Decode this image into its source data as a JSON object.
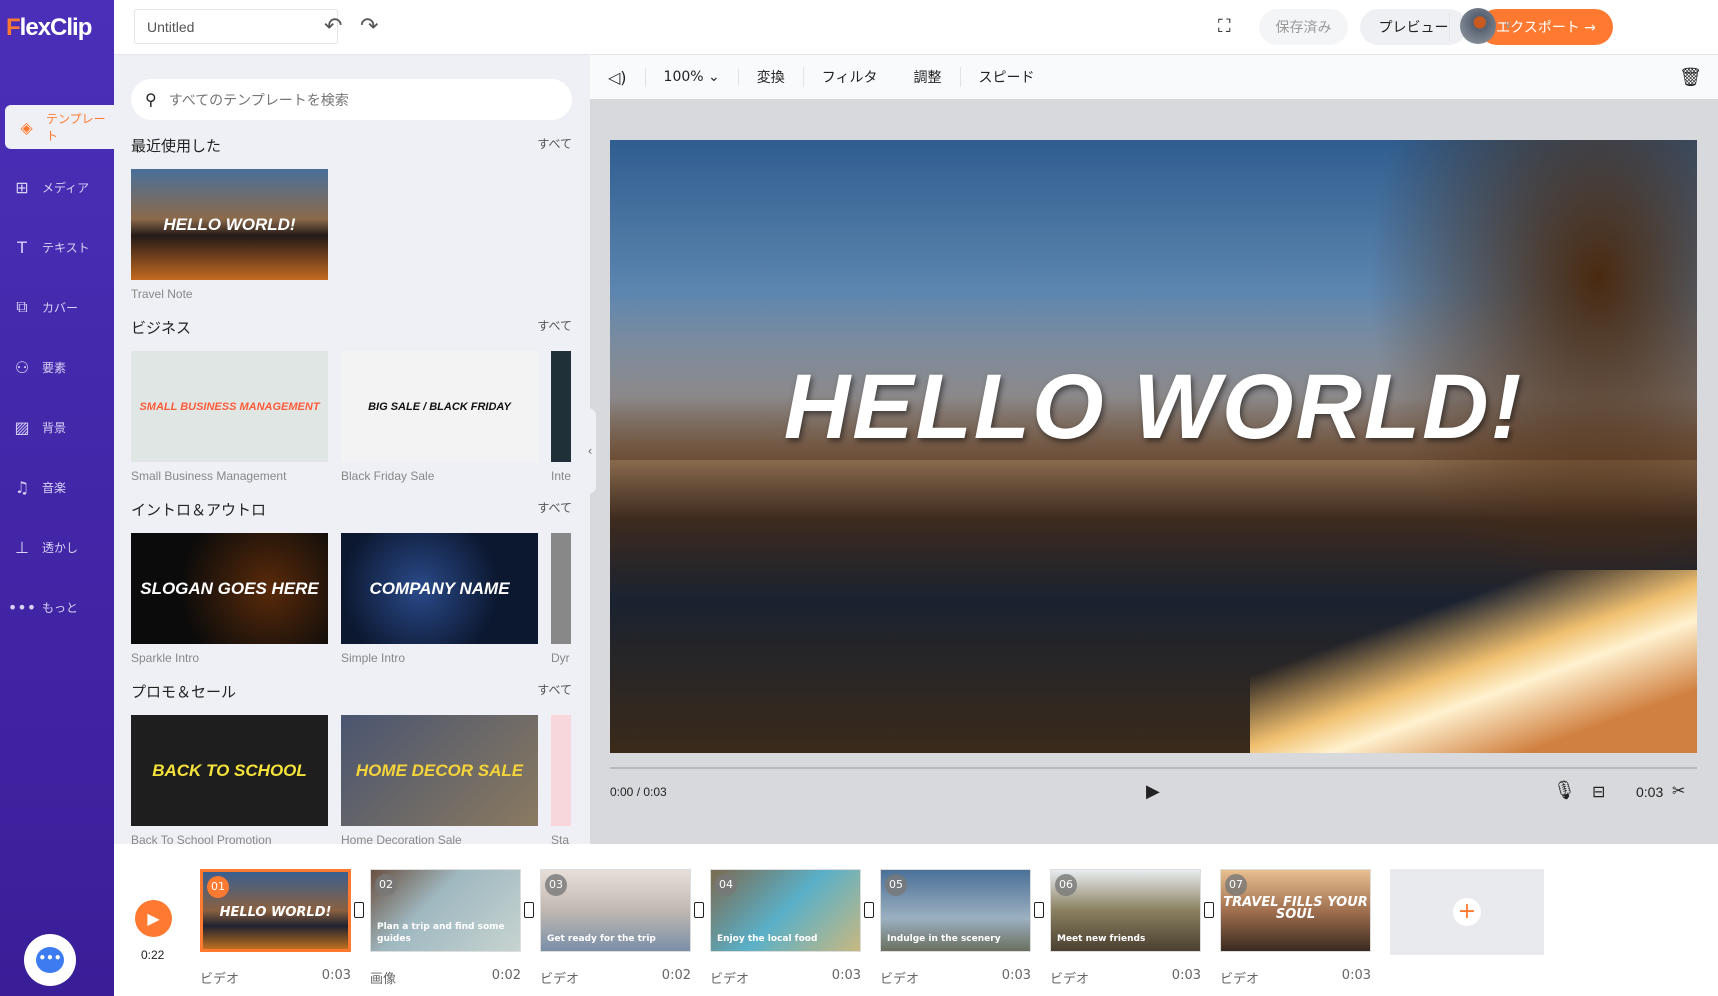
{
  "brand": {
    "logo_f": "F",
    "logo_rest": "lexClip",
    "accent": "#ff7a30",
    "sidebar_color": "#4a2fb5"
  },
  "sidebar": {
    "items": [
      {
        "label": "テンプレート",
        "icon": "layers-icon",
        "glyph": "◈",
        "active": true
      },
      {
        "label": "メディア",
        "icon": "folder-plus-icon",
        "glyph": "⊞"
      },
      {
        "label": "テキスト",
        "icon": "text-icon",
        "glyph": "T"
      },
      {
        "label": "カバー",
        "icon": "cover-icon",
        "glyph": "⧉"
      },
      {
        "label": "要素",
        "icon": "elements-icon",
        "glyph": "⚇"
      },
      {
        "label": "背景",
        "icon": "background-icon",
        "glyph": "▨"
      },
      {
        "label": "音楽",
        "icon": "music-icon",
        "glyph": "♫"
      },
      {
        "label": "透かし",
        "icon": "watermark-icon",
        "glyph": "⊥"
      },
      {
        "label": "もっと",
        "icon": "more-icon",
        "glyph": "•••"
      }
    ]
  },
  "topbar": {
    "title": "Untitled",
    "saved": "保存済み",
    "preview": "プレビュー",
    "export": "エクスポート →"
  },
  "panel": {
    "search_placeholder": "すべてのテンプレートを検索",
    "all_label": "すべて",
    "sections": [
      {
        "title": "最近使用した",
        "items": [
          {
            "label": "Travel Note",
            "art": "HELLO WORLD!",
            "bg": "linear-gradient(180deg,#4a6f9a,#8b6a4a 45%,#241a18 60%,#c46a20)"
          }
        ]
      },
      {
        "title": "ビジネス",
        "items": [
          {
            "label": "Small Business Management",
            "art": "SMALL BUSINESS MANAGEMENT",
            "bg": "#dfe6e3",
            "fg": "#ff5b3a"
          },
          {
            "label": "Black Friday Sale",
            "art": "BIG SALE / BLACK FRIDAY",
            "bg": "#f3f3f3",
            "fg": "#111"
          },
          {
            "label": "Inte",
            "bg": "#1f3038"
          }
        ]
      },
      {
        "title": "イントロ＆アウトロ",
        "items": [
          {
            "label": "Sparkle Intro",
            "art": "SLOGAN GOES HERE",
            "bg": "radial-gradient(circle at 70% 50%,#5a2a0a,#0b0b0b 60%)"
          },
          {
            "label": "Simple Intro",
            "art": "COMPANY NAME",
            "bg": "radial-gradient(circle at 40% 50%,#2a4a8a,#0c1830 60%)"
          },
          {
            "label": "Dyr",
            "bg": "#888"
          }
        ]
      },
      {
        "title": "プロモ＆セール",
        "items": [
          {
            "label": "Back To School Promotion",
            "art": "BACK TO SCHOOL",
            "bg": "#1e1e1e",
            "fg": "#f5e23a"
          },
          {
            "label": "Home Decoration Sale",
            "art": "HOME DECOR SALE",
            "bg": "linear-gradient(135deg,#4a5570,#8a7a60)",
            "fg": "#f5d43a"
          },
          {
            "label": "Sta",
            "bg": "#f7d7dc"
          }
        ]
      }
    ]
  },
  "player": {
    "volume_icon": "speaker-icon",
    "zoom": "100%",
    "tools": [
      "変換",
      "フィルタ",
      "調整",
      "スピード"
    ],
    "time": "0:00 / 0:03",
    "clip_duration": "0:03",
    "overlay_text": "HELLO WORLD!"
  },
  "timeline": {
    "total": "0:22",
    "clips": [
      {
        "num": "01",
        "type": "ビデオ",
        "dur": "0:03",
        "text": "HELLO WORLD!",
        "bg": "linear-gradient(180deg,#3a5f8f,#8a6040 50%,#1e2230 70%,#c0701f)",
        "selected": true
      },
      {
        "num": "02",
        "type": "画像",
        "dur": "0:02",
        "text": "Plan a trip and find some guides",
        "bg": "linear-gradient(135deg,#6a5040,#9fb8c0 40%,#c7d4d0)"
      },
      {
        "num": "03",
        "type": "ビデオ",
        "dur": "0:02",
        "text": "Get ready for the trip",
        "bg": "linear-gradient(180deg,#e8e0d8,#c0b8b0 50%,#7a8fa8)"
      },
      {
        "num": "04",
        "type": "ビデオ",
        "dur": "0:03",
        "text": "Enjoy the local food",
        "bg": "linear-gradient(135deg,#7a6a50,#5ab0c8 50%,#c8b880)"
      },
      {
        "num": "05",
        "type": "ビデオ",
        "dur": "0:03",
        "text": "Indulge in the scenery",
        "bg": "linear-gradient(180deg,#4a7098,#9cb0c0 60%,#6a7060)"
      },
      {
        "num": "06",
        "type": "ビデオ",
        "dur": "0:03",
        "text": "Meet new friends",
        "bg": "linear-gradient(180deg,#e8ecef,#8a8060 50%,#4a4030)"
      },
      {
        "num": "07",
        "type": "ビデオ",
        "dur": "0:03",
        "text": "TRAVEL FILLS YOUR SOUL",
        "bg": "linear-gradient(180deg,#e8c090,#a07050 50%,#3a2a20)"
      }
    ]
  }
}
